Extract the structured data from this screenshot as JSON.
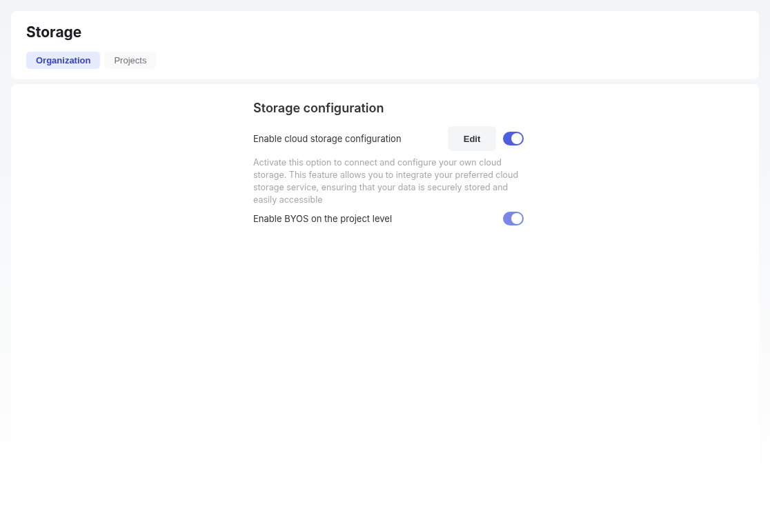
{
  "page": {
    "title": "Storage"
  },
  "tabs": [
    {
      "label": "Organization",
      "selected": true
    },
    {
      "label": "Projects",
      "selected": false
    }
  ],
  "section": {
    "title": "Storage configuration",
    "settings": [
      {
        "kind": "toggle_with_button",
        "label": "Enable cloud storage configuration",
        "button": "Edit",
        "on": true,
        "disabled": false,
        "description": "Activate this option to connect and configure your own cloud storage. This feature allows you to integrate your preferred cloud storage service, ensuring that your data is securely stored and easily accessible"
      },
      {
        "kind": "toggle",
        "label": "Enable BYOS on the project level",
        "on": true,
        "disabled": true
      }
    ]
  }
}
